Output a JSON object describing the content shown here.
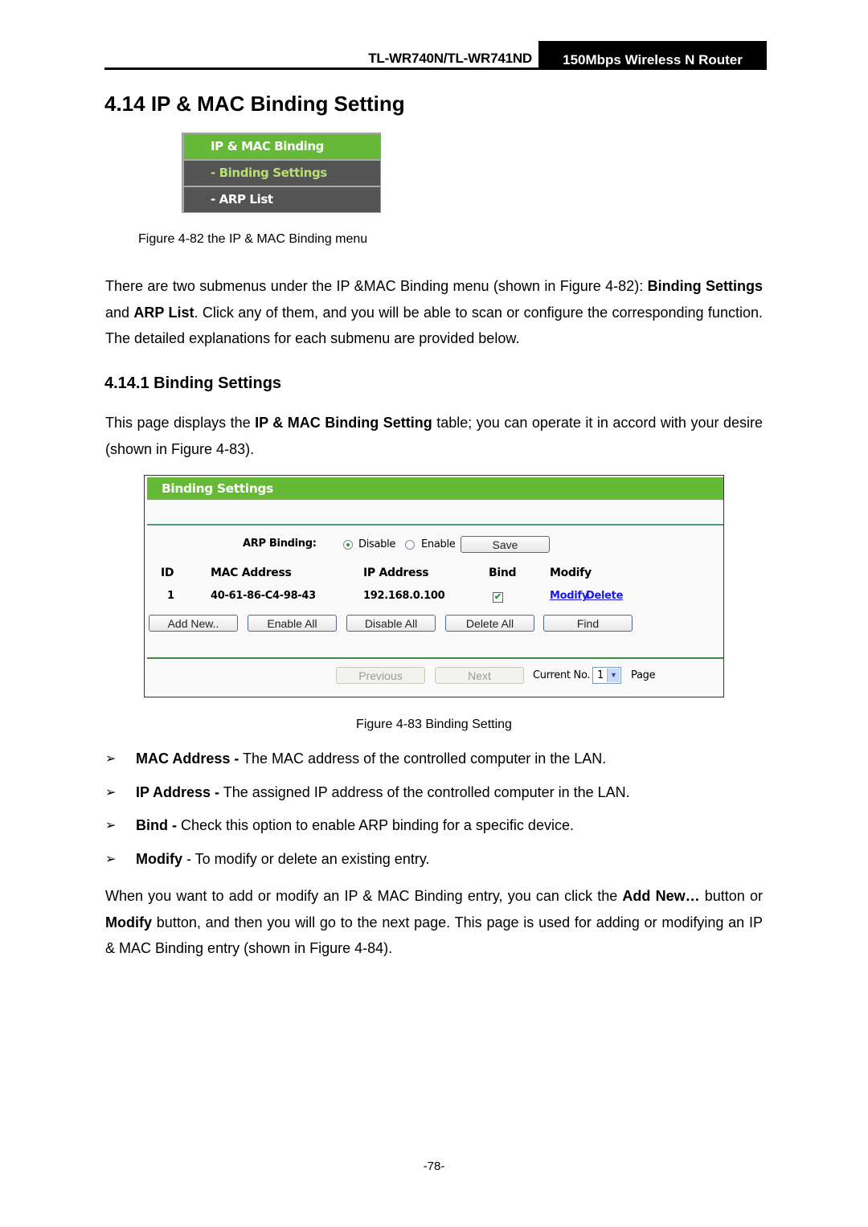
{
  "header": {
    "model": "TL-WR740N/TL-WR741ND",
    "product": "150Mbps Wireless N Router"
  },
  "section": {
    "title": "4.14  IP & MAC Binding Setting"
  },
  "menu_figure": {
    "items": [
      {
        "label": "IP & MAC Binding",
        "state": "active-parent"
      },
      {
        "label": "- Binding Settings",
        "state": "selected"
      },
      {
        "label": "- ARP List",
        "state": "normal"
      }
    ],
    "caption": "Figure 4-82 the IP & MAC Binding menu",
    "colors": {
      "green": "#66b936",
      "dark": "#545454",
      "selected_text": "#b8e070"
    }
  },
  "paragraph1": {
    "t1": "There are two submenus under the IP &MAC Binding menu (shown in Figure 4-82): ",
    "b1": "Binding Settings",
    "t2": " and ",
    "b2": "ARP List",
    "t3": ". Click any of them, and you will be able to scan or configure the corresponding function. The detailed explanations for each submenu are provided below."
  },
  "subsection": {
    "title": "4.14.1  Binding Settings"
  },
  "paragraph2": {
    "t1": "This page displays the ",
    "b1": "IP & MAC Binding Setting",
    "t2": " table; you can operate it in accord with your desire (shown in Figure 4-83)."
  },
  "binding_panel": {
    "title": "Binding Settings",
    "arp_binding_label": "ARP Binding:",
    "radio_disable": "Disable",
    "radio_enable": "Enable",
    "selected_radio": "Disable",
    "save_button": "Save",
    "table": {
      "headers": [
        "ID",
        "MAC Address",
        "IP Address",
        "Bind",
        "Modify"
      ],
      "rows": [
        {
          "id": "1",
          "mac": "40-61-86-C4-98-43",
          "ip": "192.168.0.100",
          "bind": true,
          "modify_link": "Modify",
          "delete_link": "Delete"
        }
      ]
    },
    "buttons": {
      "add_new": "Add New..",
      "enable_all": "Enable All",
      "disable_all": "Disable All",
      "delete_all": "Delete All",
      "find": "Find"
    },
    "pagination": {
      "previous": "Previous",
      "next": "Next",
      "current_label": "Current No.",
      "current_value": "1",
      "page_label": "Page"
    },
    "caption": "Figure 4-83 Binding Setting"
  },
  "bullets": [
    {
      "term": "MAC Address -",
      "desc": " The MAC address of the controlled computer in the LAN."
    },
    {
      "term": "IP Address -",
      "desc": " The assigned IP address of the controlled computer in the LAN."
    },
    {
      "term": "Bind -",
      "desc": " Check this option to enable ARP binding for a specific device."
    },
    {
      "term": "Modify",
      "desc": " - To modify or delete an existing entry."
    }
  ],
  "paragraph3": {
    "t1": "When you want to add or modify an IP & MAC Binding entry, you can click the ",
    "b1": "Add New…",
    "t2": " button or ",
    "b2": "Modify",
    "t3": " button, and then you will go to the next page. This page is used for adding or modifying an IP & MAC Binding entry (shown in Figure 4-84)."
  },
  "footer": {
    "page_number": "-78-"
  }
}
